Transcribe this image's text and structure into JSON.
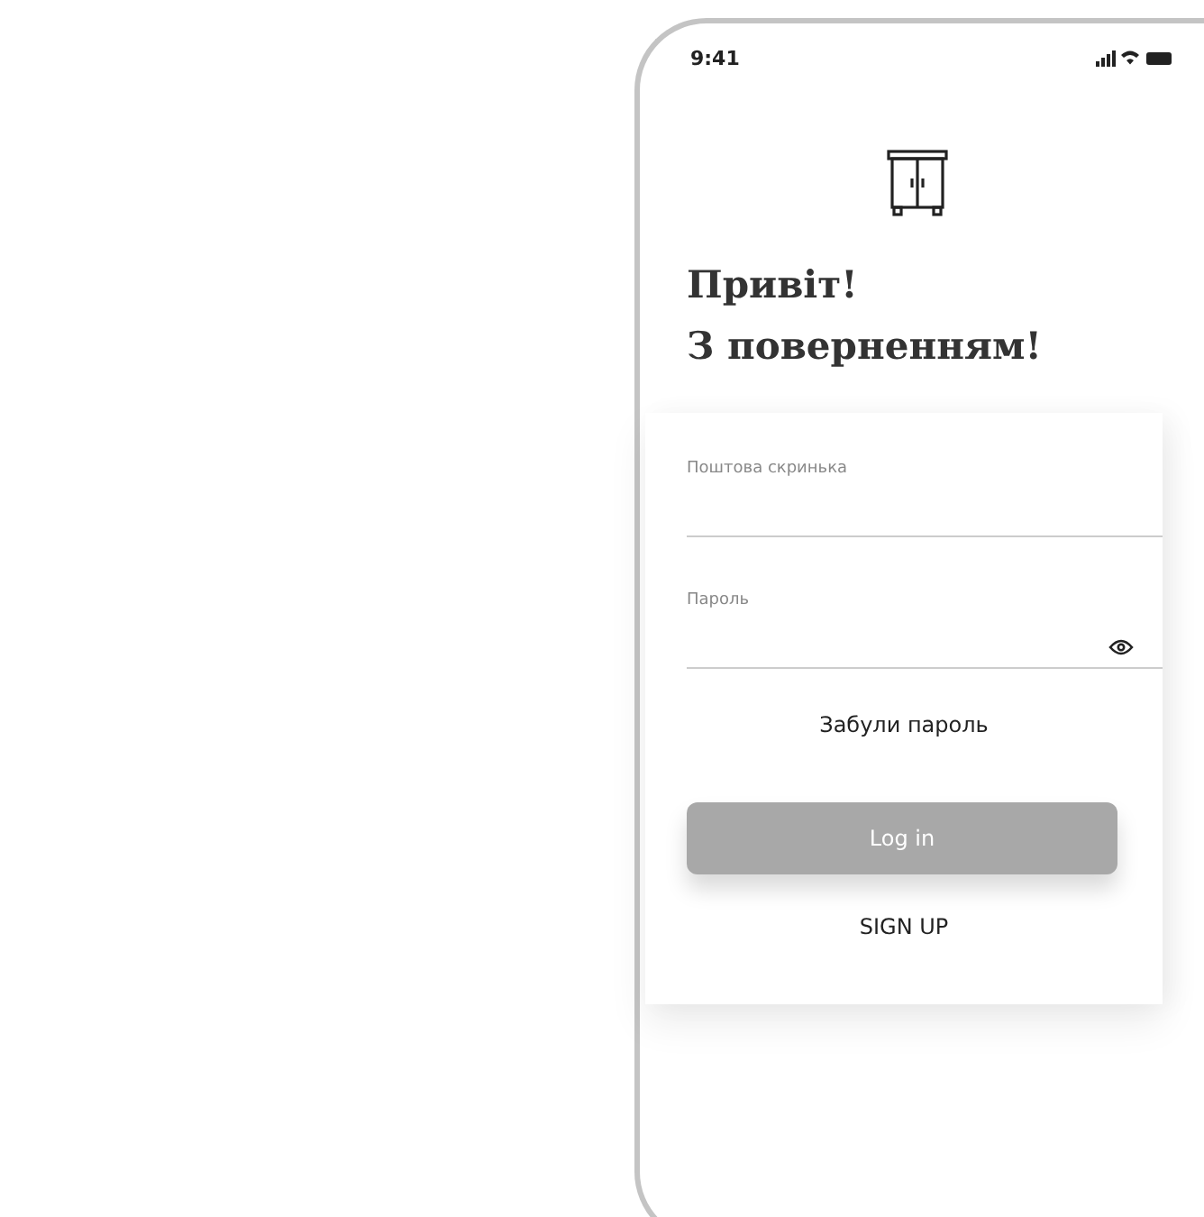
{
  "status_bar": {
    "time": "9:41"
  },
  "greeting": {
    "lines": [
      "Привіт!",
      "З поверненням!"
    ]
  },
  "form": {
    "fields": [
      {
        "label": "Поштова скринька",
        "kind": "text"
      },
      {
        "label": "Пароль",
        "kind": "password"
      }
    ],
    "forgot_link": "Забули пароль",
    "login_button": "Log in",
    "signup_link": "SIGN UP"
  }
}
